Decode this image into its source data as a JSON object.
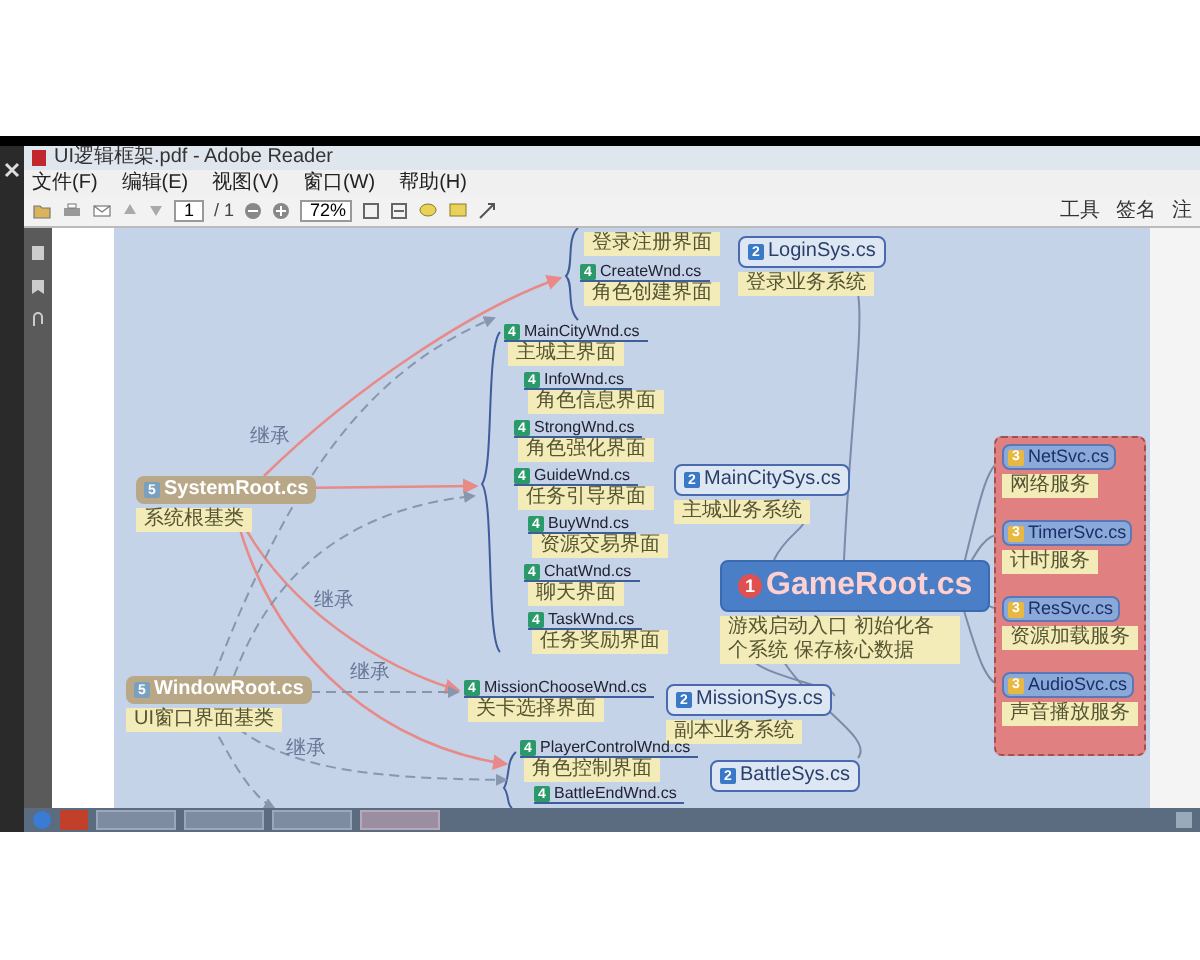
{
  "window": {
    "title": "UI逻辑框架.pdf - Adobe Reader"
  },
  "menu": [
    "文件(F)",
    "编辑(E)",
    "视图(V)",
    "窗口(W)",
    "帮助(H)"
  ],
  "toolbar": {
    "page": "1",
    "page_count": "/ 1",
    "zoom": "72%"
  },
  "panel_tabs": [
    "工具",
    "签名",
    "注"
  ],
  "mindmap": {
    "nodes": [
      {
        "kind": "wnd",
        "note": "登录注册界面"
      },
      {
        "kind": "wnd",
        "badge": "4",
        "name": "CreateWnd.cs",
        "note": "角色创建界面"
      },
      {
        "kind": "sys",
        "badge": "2",
        "name": "LoginSys.cs",
        "note": "登录业务系统"
      },
      {
        "kind": "wnd",
        "badge": "4",
        "name": "MainCityWnd.cs",
        "note": "主城主界面"
      },
      {
        "kind": "wnd",
        "badge": "4",
        "name": "InfoWnd.cs",
        "note": "角色信息界面"
      },
      {
        "kind": "wnd",
        "badge": "4",
        "name": "StrongWnd.cs",
        "note": "角色强化界面"
      },
      {
        "kind": "wnd",
        "badge": "4",
        "name": "GuideWnd.cs",
        "note": "任务引导界面"
      },
      {
        "kind": "wnd",
        "badge": "4",
        "name": "BuyWnd.cs",
        "note": "资源交易界面"
      },
      {
        "kind": "wnd",
        "badge": "4",
        "name": "ChatWnd.cs",
        "note": "聊天界面"
      },
      {
        "kind": "wnd",
        "badge": "4",
        "name": "TaskWnd.cs",
        "note": "任务奖励界面"
      },
      {
        "kind": "base",
        "badge": "5",
        "name": "SystemRoot.cs",
        "note": "系统根基类"
      },
      {
        "kind": "sys",
        "badge": "2",
        "name": "MainCitySys.cs",
        "note": "主城业务系统"
      },
      {
        "kind": "svc",
        "badge": "3",
        "name": "NetSvc.cs",
        "note": "网络服务"
      },
      {
        "kind": "svc",
        "badge": "3",
        "name": "TimerSvc.cs",
        "note": "计时服务"
      },
      {
        "kind": "root",
        "badge": "1",
        "name": "GameRoot.cs",
        "note": "游戏启动入口 初始化各个系统 保存核心数据"
      },
      {
        "kind": "svc",
        "badge": "3",
        "name": "ResSvc.cs",
        "note": "资源加载服务"
      },
      {
        "kind": "base",
        "badge": "5",
        "name": "WindowRoot.cs",
        "note": "UI窗口界面基类"
      },
      {
        "kind": "wnd",
        "badge": "4",
        "name": "MissionChooseWnd.cs",
        "note": "关卡选择界面"
      },
      {
        "kind": "sys",
        "badge": "2",
        "name": "MissionSys.cs",
        "note": "副本业务系统"
      },
      {
        "kind": "svc",
        "badge": "3",
        "name": "AudioSvc.cs",
        "note": "声音播放服务"
      },
      {
        "kind": "wnd",
        "badge": "4",
        "name": "PlayerControlWnd.cs",
        "note": "角色控制界面"
      },
      {
        "kind": "sys",
        "badge": "2",
        "name": "BattleSys.cs"
      },
      {
        "kind": "wnd",
        "badge": "4",
        "name": "BattleEndWnd.cs"
      }
    ],
    "edge_labels": [
      "继承",
      "继承",
      "继承",
      "继承"
    ]
  }
}
